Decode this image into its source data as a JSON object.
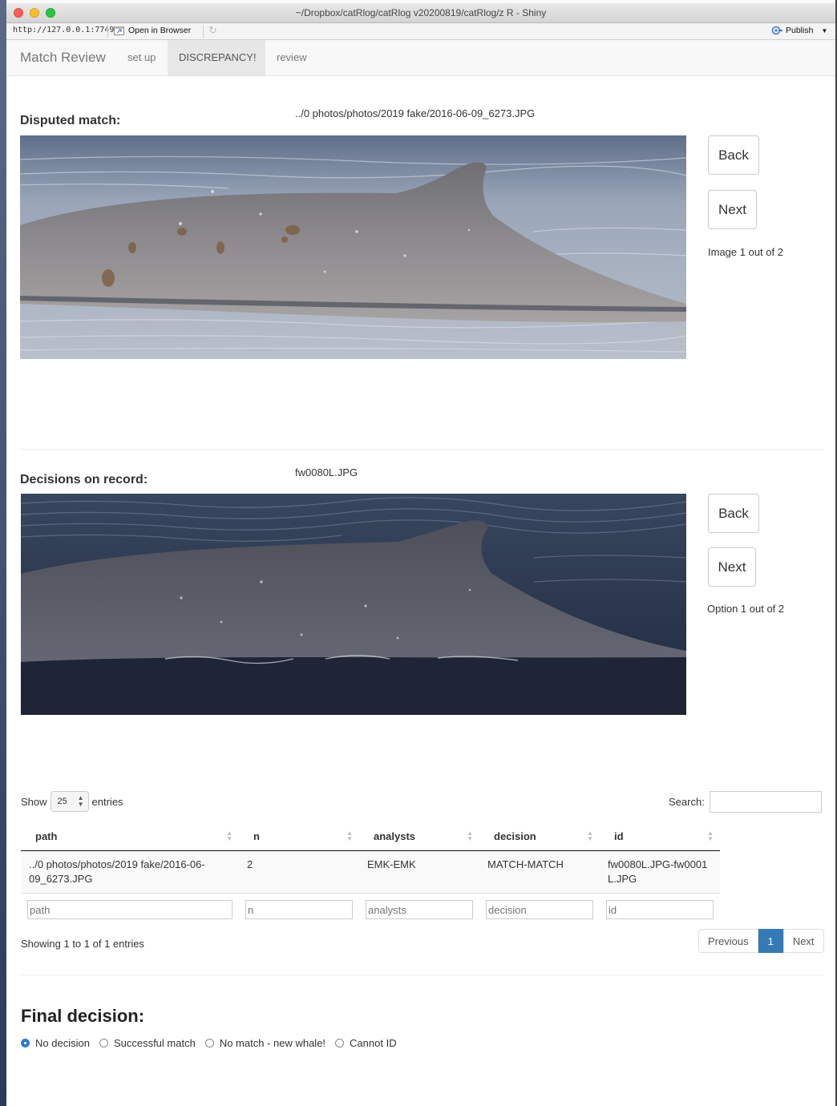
{
  "window": {
    "title": "~/Dropbox/catRlog/catRlog v20200819/catRlog/z R - Shiny",
    "colors": {
      "close": "#fc5f57",
      "minimize": "#fdbc2e",
      "zoom": "#28c840"
    }
  },
  "addressbar": {
    "url": "http://127.0.0.1:7749",
    "open_in_browser": "Open in Browser",
    "publish": "Publish"
  },
  "navbar": {
    "brand": "Match Review",
    "tabs": [
      {
        "label": "set up",
        "active": false
      },
      {
        "label": "DISCREPANCY!",
        "active": true
      },
      {
        "label": "review",
        "active": false
      }
    ]
  },
  "disputed": {
    "label": "Disputed match:",
    "file": "../0 photos/photos/2019 fake/2016-06-09_6273.JPG",
    "back": "Back",
    "next": "Next",
    "counter": "Image 1 out of 2"
  },
  "decisions": {
    "label": "Decisions on record:",
    "file": "fw0080L.JPG",
    "back": "Back",
    "next": "Next",
    "counter": "Option 1 out of 2"
  },
  "table": {
    "show_label": "Show",
    "entries_value": "25",
    "entries_label": "entries",
    "search_label": "Search:",
    "columns": [
      "path",
      "n",
      "analysts",
      "decision",
      "id"
    ],
    "rows": [
      {
        "path": "../0 photos/photos/2019 fake/2016-06-09_6273.JPG",
        "n": "2",
        "analysts": "EMK-EMK",
        "decision": "MATCH-MATCH",
        "id": "fw0080L.JPG-fw0001L.JPG"
      }
    ],
    "filter_placeholders": [
      "path",
      "n",
      "analysts",
      "decision",
      "id"
    ],
    "info": "Showing 1 to 1 of 1 entries",
    "pager": {
      "previous": "Previous",
      "current": "1",
      "next": "Next"
    }
  },
  "final": {
    "title": "Final decision:",
    "options": [
      "No decision",
      "Successful match",
      "No match - new whale!",
      "Cannot ID"
    ],
    "selected": "No decision",
    "accent": "#2b7ad6"
  }
}
